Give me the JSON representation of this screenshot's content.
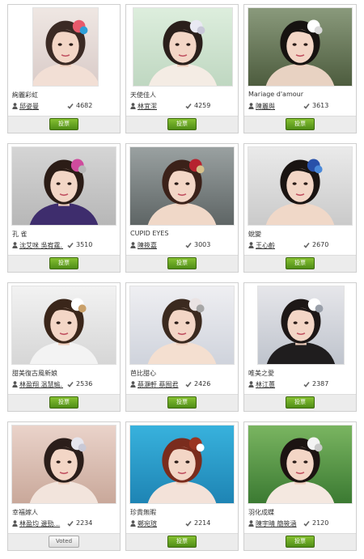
{
  "vote_label": "投票",
  "voted_label": "Voted",
  "colors": {
    "button_green": "#5a9a1c",
    "border": "#cfcfcf",
    "footer_bg": "#ececec"
  },
  "entries": [
    {
      "title": "絢麗彩虹",
      "author": "邱姿曼",
      "votes": "4682",
      "voted": false
    },
    {
      "title": "天使佳人",
      "author": "林宜潔",
      "votes": "4259",
      "voted": false
    },
    {
      "title": "Mariage d'amour",
      "author": "陳麗與",
      "votes": "3613",
      "voted": false
    },
    {
      "title": "孔 雀",
      "author": "沈艾咪 吳宥霆...",
      "votes": "3510",
      "voted": false
    },
    {
      "title": "CUPID EYES",
      "author": "陳筱嘉",
      "votes": "3003",
      "voted": false
    },
    {
      "title": "蛻變",
      "author": "王心齡",
      "votes": "2670",
      "voted": false
    },
    {
      "title": "甜美復古風新娘",
      "author": "林盈翔 温慧瑜...",
      "votes": "2536",
      "voted": false
    },
    {
      "title": "芭比甜心",
      "author": "蔡灝軒 蔡囿君",
      "votes": "2426",
      "voted": false
    },
    {
      "title": "唯美之愛",
      "author": "林江蕙",
      "votes": "2387",
      "voted": false
    },
    {
      "title": "幸福嫁人",
      "author": "林盈均 邊勁...",
      "votes": "2234",
      "voted": true
    },
    {
      "title": "珍貴無暇",
      "author": "鄭宛瑄",
      "votes": "2214",
      "voted": false
    },
    {
      "title": "羽化成蝶",
      "author": "陳宇晴 簡筱涵",
      "votes": "2120",
      "voted": false
    }
  ]
}
